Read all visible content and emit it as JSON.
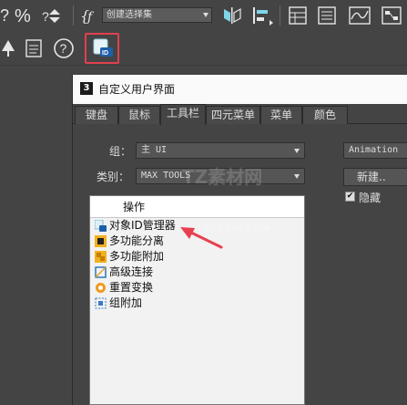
{
  "toolbar": {
    "selection_set_placeholder": "创建选择集"
  },
  "dialog": {
    "title": "自定义用户界面",
    "app_badge": "3",
    "tabs": [
      "键盘",
      "鼠标",
      "工具栏",
      "四元菜单",
      "菜单",
      "颜色"
    ],
    "active_tab": "工具栏",
    "group_label": "组：",
    "group_value": "主 UI",
    "category_label": "类别：",
    "category_value": "MAX TOOLS",
    "list_header": "操作",
    "list_items": [
      {
        "label": "对象ID管理器",
        "icon": "object-id-manager-icon"
      },
      {
        "label": "多功能分离",
        "icon": "multi-detach-icon"
      },
      {
        "label": "多功能附加",
        "icon": "multi-attach-icon"
      },
      {
        "label": "高级连接",
        "icon": "advanced-connect-icon"
      },
      {
        "label": "重置变换",
        "icon": "reset-xform-icon"
      },
      {
        "label": "组附加",
        "icon": "group-attach-icon"
      }
    ],
    "right_dropdown": "Animation L",
    "new_button": "新建..",
    "hide_checkbox_label": "隐藏",
    "hide_checked": true
  },
  "watermark": {
    "brand": "TZ素材网",
    "url": "TZSUCAI.COM"
  },
  "colors": {
    "highlight_border": "#e04050",
    "annotation_arrow": "#e8404f",
    "titlebar_bg": "#fafafa"
  }
}
